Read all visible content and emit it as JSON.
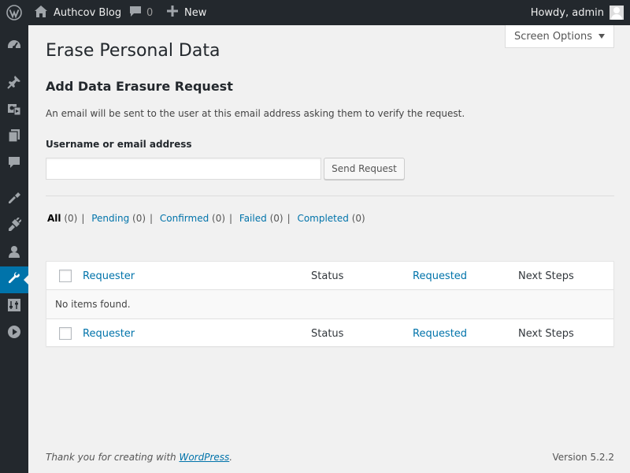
{
  "admin_bar": {
    "site_name": "Authcov Blog",
    "comments_count": "0",
    "new_label": "New",
    "greeting": "Howdy, admin"
  },
  "sidebar": {
    "items": [
      {
        "icon": "dashboard-icon"
      },
      {
        "icon": "pin-icon"
      },
      {
        "icon": "media-icon"
      },
      {
        "icon": "pages-icon"
      },
      {
        "icon": "comments-icon"
      },
      {
        "icon": "appearance-icon"
      },
      {
        "icon": "plugins-icon"
      },
      {
        "icon": "users-icon"
      },
      {
        "icon": "tools-icon",
        "current": true
      },
      {
        "icon": "settings-icon"
      },
      {
        "icon": "play-icon"
      }
    ],
    "accent": "#0073aa"
  },
  "screen_options": {
    "label": "Screen Options"
  },
  "page": {
    "title": "Erase Personal Data",
    "form_title": "Add Data Erasure Request",
    "description": "An email will be sent to the user at this email address asking them to verify the request.",
    "field_label": "Username or email address",
    "field_value": "",
    "submit_label": "Send Request"
  },
  "filters": [
    {
      "label": "All",
      "count": "(0)",
      "current": true
    },
    {
      "label": "Pending",
      "count": "(0)"
    },
    {
      "label": "Confirmed",
      "count": "(0)"
    },
    {
      "label": "Failed",
      "count": "(0)"
    },
    {
      "label": "Completed",
      "count": "(0)"
    }
  ],
  "table": {
    "columns": {
      "requester": "Requester",
      "status": "Status",
      "requested": "Requested",
      "next_steps": "Next Steps"
    },
    "empty_message": "No items found."
  },
  "footer": {
    "thanks_prefix": "Thank you for creating with ",
    "thanks_link": "WordPress",
    "thanks_suffix": ".",
    "version": "Version 5.2.2"
  }
}
